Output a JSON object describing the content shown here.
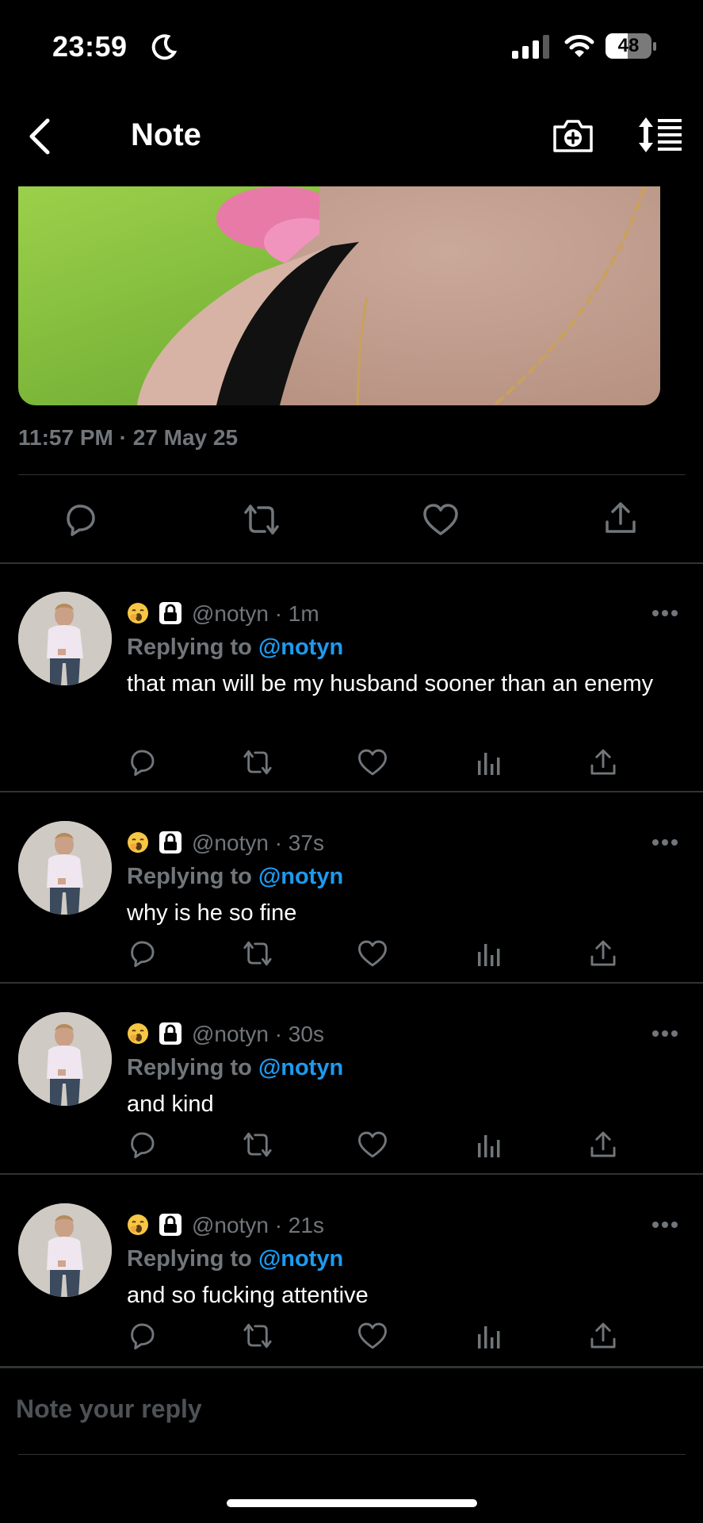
{
  "status_bar": {
    "time": "23:59",
    "battery": "48",
    "battery_level": 0.48
  },
  "header": {
    "title": "Note"
  },
  "post": {
    "timestamp": "11:57 PM · 27 May 25"
  },
  "replies": [
    {
      "handle": "@notyn",
      "age": "1m",
      "meta": "@notyn · 1m",
      "replying_label": "Replying to",
      "replying_handle": "@notyn",
      "text": "that man will be my husband sooner than an enemy"
    },
    {
      "handle": "@notyn",
      "age": "37s",
      "meta": "@notyn · 37s",
      "replying_label": "Replying to",
      "replying_handle": "@notyn",
      "text": "why is he so fine"
    },
    {
      "handle": "@notyn",
      "age": "30s",
      "meta": "@notyn · 30s",
      "replying_label": "Replying to",
      "replying_handle": "@notyn",
      "text": "and kind"
    },
    {
      "handle": "@notyn",
      "age": "21s",
      "meta": "@notyn · 21s",
      "replying_label": "Replying to",
      "replying_handle": "@notyn",
      "text": "and so fucking attentive"
    }
  ],
  "composer": {
    "placeholder": "Note your reply"
  },
  "icons": [
    "back-icon",
    "camera-plus-icon",
    "sort-icon",
    "reply-icon",
    "repost-icon",
    "like-icon",
    "views-icon",
    "share-icon",
    "more-icon",
    "lock-icon",
    "yawn-emoji-icon",
    "moon-icon",
    "signal-icon",
    "wifi-icon",
    "battery-icon"
  ],
  "colors": {
    "background": "#000000",
    "accent": "#1d9bf0",
    "muted": "#71767b",
    "divider": "#2f3336"
  }
}
